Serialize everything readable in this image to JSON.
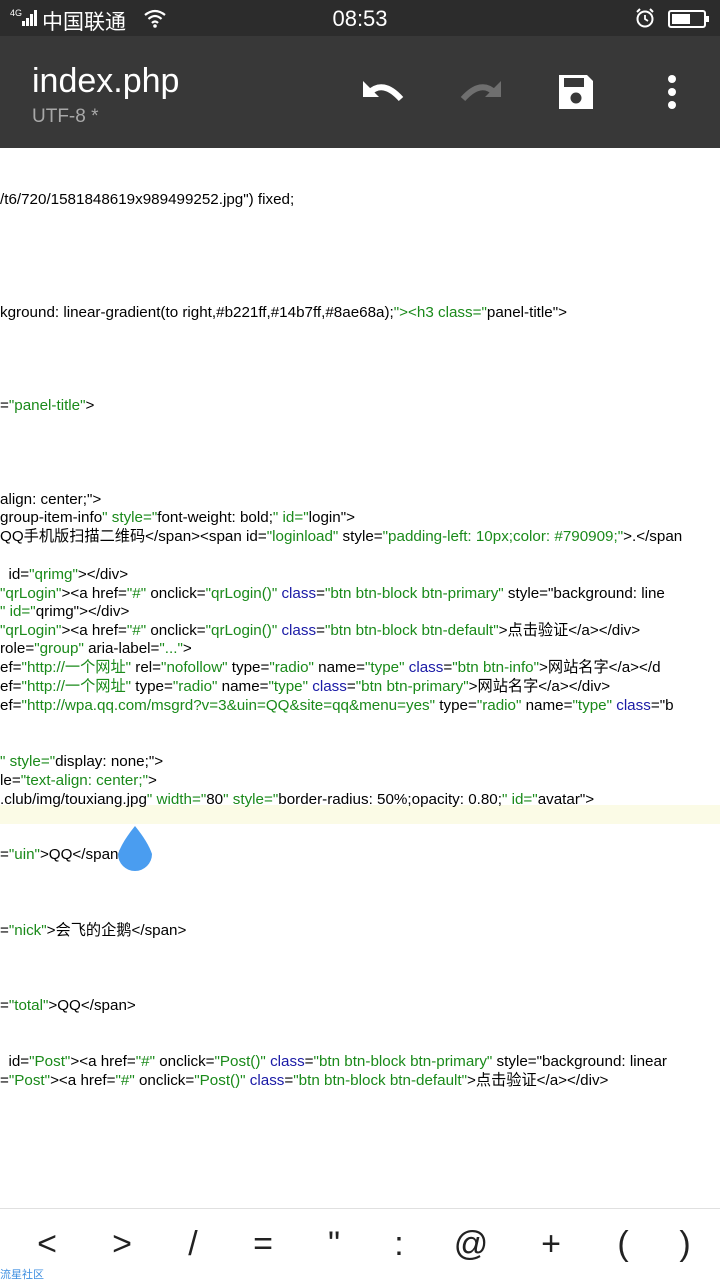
{
  "status_bar": {
    "network": "4G",
    "carrier": "中国联通",
    "time": "08:53"
  },
  "toolbar": {
    "title": "index.php",
    "subtitle": "UTF-8 *"
  },
  "editor": {
    "lines": [
      "/t6/720/1581848619x989499252.jpg\") fixed;",
      "kground: linear-gradient(to right,#b221ff,#14b7ff,#8ae68a);\"><h3 class=\"panel-title\">",
      "=\"panel-title\">",
      "align: center;\">",
      "group-item-info\" style=\"font-weight: bold;\" id=\"login\">",
      "QQ手机版扫描二维码</span><span id=\"loginload\" style=\"padding-left: 10px;color: #790909;\">.</span",
      "  id=\"qrimg\"></div>",
      "\"qrLogin\"><a href=\"#\" onclick=\"qrLogin()\" class=\"btn btn-block btn-primary\" style=\"background: line",
      "\" id=\"qrimg\"></div>",
      "\"qrLogin\"><a href=\"#\" onclick=\"qrLogin()\" class=\"btn btn-block btn-default\">点击验证</a></div>",
      "role=\"group\" aria-label=\"...\">",
      "ef=\"http://一个网址\" rel=\"nofollow\" type=\"radio\" name=\"type\" class=\"btn btn-info\">网站名字</a></d",
      "ef=\"http://一个网址\" type=\"radio\" name=\"type\" class=\"btn btn-primary\">网站名字</a></div>",
      "ef=\"http://wpa.qq.com/msgrd?v=3&uin=QQ&site=qq&menu=yes\" type=\"radio\" name=\"type\" class=\"b",
      "\" style=\"display: none;\">",
      "le=\"text-align: center;\">",
      ".club/img/touxiang.jpg\" width=\"80\" style=\"border-radius: 50%;opacity: 0.80;\" id=\"avatar\">",
      "=\"uin\">QQ</span>",
      "=\"nick\">会飞的企鹅</span>",
      "=\"total\">QQ</span>",
      "  id=\"Post\"><a href=\"#\" onclick=\"Post()\" class=\"btn btn-block btn-primary\" style=\"background: linear",
      "=\"Post\"><a href=\"#\" onclick=\"Post()\" class=\"btn btn-block btn-default\">点击验证</a></div>"
    ]
  },
  "symbols": [
    "<",
    ">",
    "/",
    "=",
    "\"",
    ":",
    "@",
    "+",
    "(",
    ")"
  ],
  "watermark": "流星社区",
  "colors": {
    "string": "#1a8a1a",
    "attribute": "#1a1aa6",
    "toolbar": "#383838",
    "status": "#2c2c2c",
    "drop": "#4a9df0"
  }
}
